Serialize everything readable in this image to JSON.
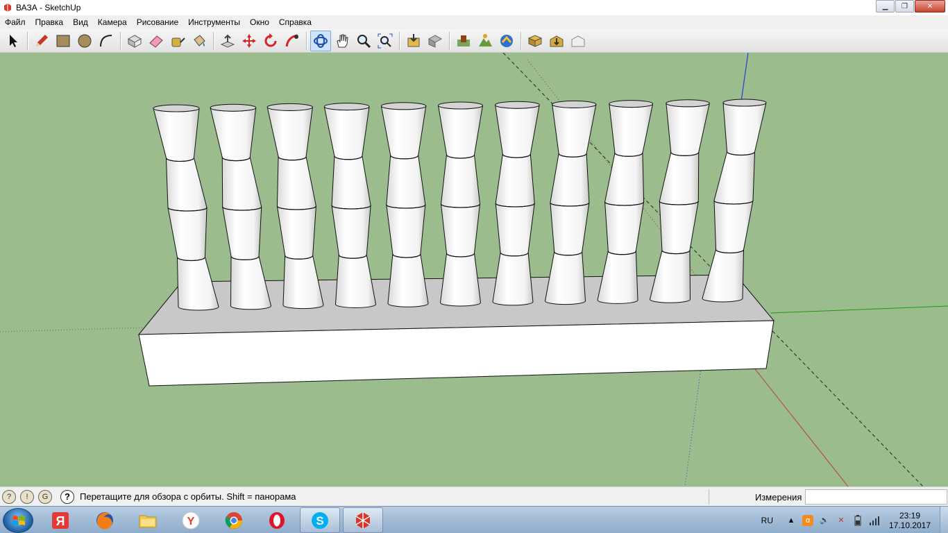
{
  "window": {
    "title": "ВАЗА - SketchUp",
    "minimize_label": "▁",
    "maximize_label": "❐",
    "close_label": "✕"
  },
  "menu": {
    "items": [
      "Файл",
      "Правка",
      "Вид",
      "Камера",
      "Рисование",
      "Инструменты",
      "Окно",
      "Справка"
    ]
  },
  "toolbar": {
    "active_tool": "orbit",
    "tools": [
      "select-icon",
      "pencil-icon",
      "rectangle-icon",
      "circle-icon",
      "arc-icon",
      "make-component-icon",
      "eraser-icon",
      "tape-measure-icon",
      "paint-bucket-icon",
      "push-pull-icon",
      "move-icon",
      "rotate-icon",
      "follow-me-icon",
      "orbit-icon",
      "pan-icon",
      "zoom-icon",
      "zoom-extents-icon",
      "get-models-icon",
      "share-model-icon",
      "add-location-icon",
      "toggle-terrain-icon",
      "photo-textures-icon",
      "preview-3d-icon",
      "get-models-warehouse-icon",
      "share-component-icon",
      "extension-icon"
    ]
  },
  "status": {
    "hint": "Перетащите для обзора с орбиты.  Shift = панорама",
    "measurements_label": "Измерения",
    "measurements_value": ""
  },
  "taskbar": {
    "apps": [
      "yandex",
      "firefox",
      "explorer",
      "yandex-browser",
      "chrome",
      "opera",
      "skype",
      "sketchup"
    ],
    "language": "RU",
    "time": "23:19",
    "date": "17.10.2017"
  },
  "colors": {
    "viewport_bg": "#9bbc8d",
    "axis_red": "#c0392b",
    "axis_green": "#1a9a1a",
    "axis_blue": "#1f3fd0"
  },
  "model": {
    "name": "ВАЗА",
    "vase_count": 11
  }
}
